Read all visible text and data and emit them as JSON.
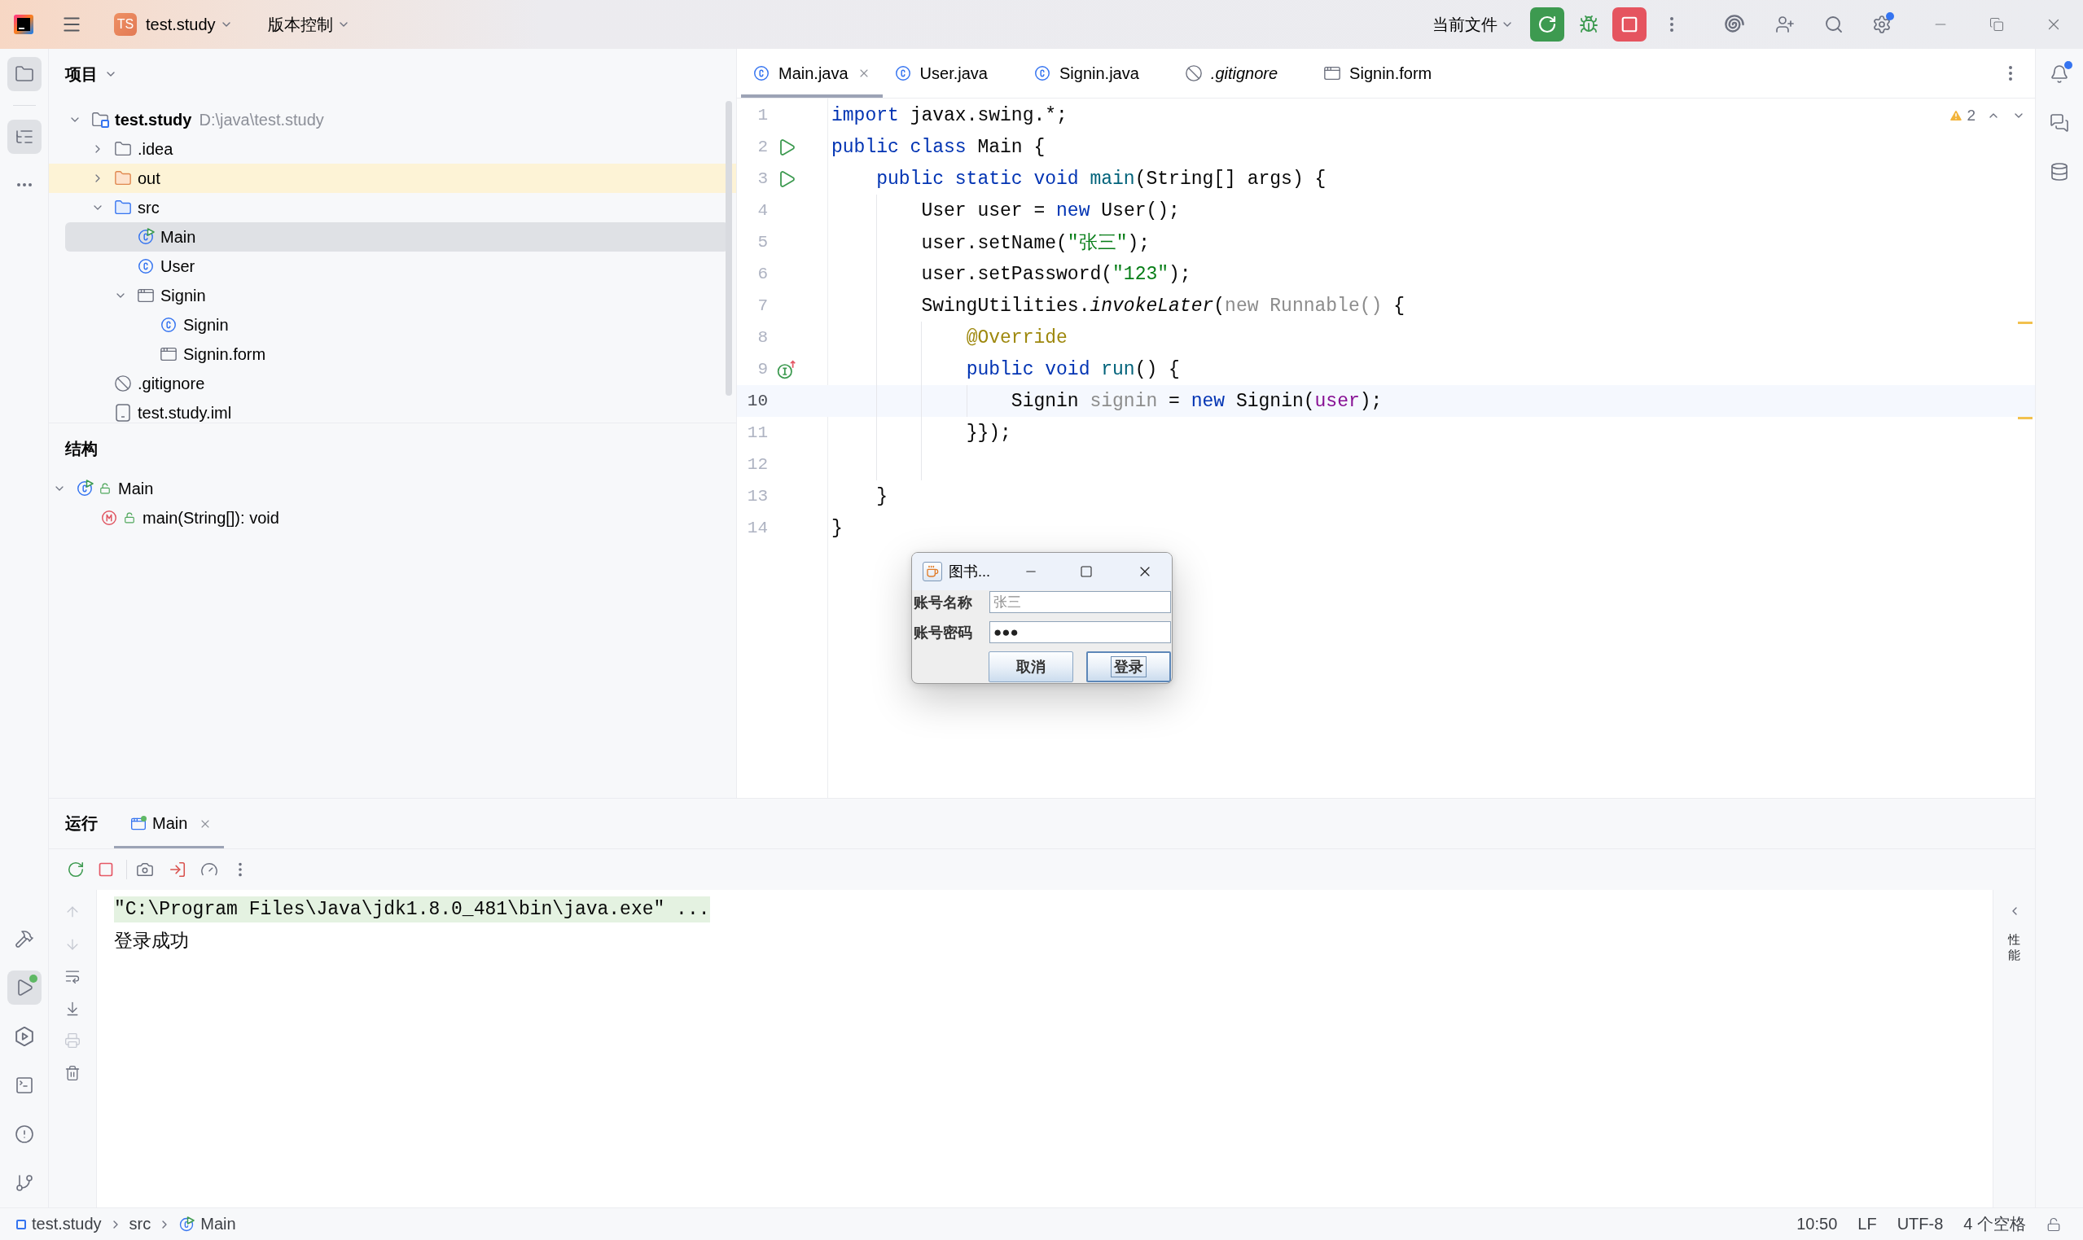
{
  "title_bar": {
    "project_badge": "TS",
    "project": "test.study",
    "vcs_menu": "版本控制",
    "run_target": "当前文件",
    "settings_badge": true
  },
  "left_toolbar": {
    "top": [
      {
        "selected": true
      },
      {
        "selected": true
      }
    ],
    "bottom": [
      {
        "selected": false
      },
      {
        "selected": true
      },
      {
        "selected": false
      },
      {
        "selected": false
      },
      {
        "selected": false
      },
      {
        "selected": false
      }
    ],
    "run_badge": true
  },
  "project_panel": {
    "title": "项目",
    "tree": [
      {
        "label": "test.study",
        "path": "D:\\java\\test.study",
        "kind": "module",
        "expanded": true,
        "selected": false,
        "children": [
          {
            "label": ".idea",
            "kind": "folder",
            "expanded": false,
            "selected": false
          },
          {
            "label": "out",
            "kind": "excluded_folder",
            "expanded": false,
            "selected": false
          },
          {
            "label": "src",
            "kind": "source_folder",
            "expanded": true,
            "selected": false,
            "children": [
              {
                "label": "Main",
                "kind": "main_class",
                "selected": true
              },
              {
                "label": "User",
                "kind": "class",
                "selected": false
              },
              {
                "label": "Signin",
                "kind": "form_group",
                "expanded": true,
                "selected": false,
                "children": [
                  {
                    "label": "Signin",
                    "kind": "class",
                    "selected": false
                  },
                  {
                    "label": "Signin.form",
                    "kind": "form",
                    "selected": false
                  }
                ]
              }
            ]
          },
          {
            "label": ".gitignore",
            "kind": "ignore_file",
            "selected": false
          },
          {
            "label": "test.study.iml",
            "kind": "module_file",
            "selected": false
          }
        ]
      }
    ]
  },
  "structure_panel": {
    "title": "结构",
    "tree": [
      {
        "label": "Main",
        "kind": "main_class",
        "expanded": true,
        "selected": false,
        "children": [
          {
            "label": "main(String[]): void",
            "kind": "method",
            "selected": false
          }
        ]
      }
    ]
  },
  "editor": {
    "tabs": [
      {
        "label": "Main.java",
        "kind": "class",
        "selected": true
      },
      {
        "label": "User.java",
        "kind": "class",
        "selected": false
      },
      {
        "label": "Signin.java",
        "kind": "class",
        "selected": false
      },
      {
        "label": ".gitignore",
        "kind": "ignored",
        "selected": false
      },
      {
        "label": "Signin.form",
        "kind": "form",
        "selected": false
      }
    ],
    "warning_count": "2",
    "lines": [
      {
        "number": "1",
        "current": false,
        "warning": false,
        "tokens": [
          {
            "kind": "keyword",
            "text": "import"
          },
          {
            "kind": "plain",
            "text": " javax.swing.*;"
          }
        ]
      },
      {
        "number": "2",
        "current": false,
        "warning": false,
        "gutter": {
          "kind": "run"
        },
        "tokens": [
          {
            "kind": "keyword",
            "text": "public class"
          },
          {
            "kind": "plain",
            "text": " Main {"
          }
        ]
      },
      {
        "number": "3",
        "current": false,
        "warning": false,
        "gutter": {
          "kind": "run"
        },
        "tokens": [
          {
            "kind": "keyword",
            "text": "    public static void "
          },
          {
            "kind": "method",
            "text": "main"
          },
          {
            "kind": "plain",
            "text": "(String[] args) {"
          }
        ]
      },
      {
        "number": "4",
        "current": false,
        "warning": false,
        "tokens": [
          {
            "kind": "plain",
            "text": "        User user = "
          },
          {
            "kind": "keyword",
            "text": "new"
          },
          {
            "kind": "plain",
            "text": " User();"
          }
        ]
      },
      {
        "number": "5",
        "current": false,
        "warning": false,
        "tokens": [
          {
            "kind": "plain",
            "text": "        user.setName("
          },
          {
            "kind": "string",
            "text": "\"张三\""
          },
          {
            "kind": "plain",
            "text": ");"
          }
        ]
      },
      {
        "number": "6",
        "current": false,
        "warning": false,
        "tokens": [
          {
            "kind": "plain",
            "text": "        user.setPassword("
          },
          {
            "kind": "string",
            "text": "\"123\""
          },
          {
            "kind": "plain",
            "text": ");"
          }
        ]
      },
      {
        "number": "7",
        "current": false,
        "warning": true,
        "tokens": [
          {
            "kind": "plain",
            "text": "        SwingUtilities."
          },
          {
            "kind": "static_call",
            "text": "invokeLater"
          },
          {
            "kind": "plain",
            "text": "("
          },
          {
            "kind": "hint",
            "text": "new Runnable()"
          },
          {
            "kind": "plain",
            "text": " {"
          }
        ]
      },
      {
        "number": "8",
        "current": false,
        "warning": false,
        "tokens": [
          {
            "kind": "annotation",
            "text": "            @Override"
          }
        ]
      },
      {
        "number": "9",
        "current": false,
        "warning": false,
        "gutter": {
          "kind": "implements"
        },
        "tokens": [
          {
            "kind": "keyword",
            "text": "            public void "
          },
          {
            "kind": "method",
            "text": "run"
          },
          {
            "kind": "plain",
            "text": "() {"
          }
        ]
      },
      {
        "number": "10",
        "current": true,
        "warning": true,
        "tokens": [
          {
            "kind": "plain",
            "text": "                Signin "
          },
          {
            "kind": "unused",
            "text": "signin"
          },
          {
            "kind": "plain",
            "text": " = "
          },
          {
            "kind": "keyword",
            "text": "new"
          },
          {
            "kind": "plain",
            "text": " Signin("
          },
          {
            "kind": "captured",
            "text": "user"
          },
          {
            "kind": "plain",
            "text": ");"
          }
        ]
      },
      {
        "number": "11",
        "current": false,
        "warning": false,
        "tokens": [
          {
            "kind": "plain",
            "text": "            }});"
          }
        ]
      },
      {
        "number": "12",
        "current": false,
        "warning": false
      },
      {
        "number": "13",
        "current": false,
        "warning": false,
        "tokens": [
          {
            "kind": "plain",
            "text": "    }"
          }
        ]
      },
      {
        "number": "14",
        "current": false,
        "warning": false,
        "tokens": [
          {
            "kind": "plain",
            "text": "}"
          }
        ]
      }
    ]
  },
  "dialog": {
    "title": "图书...",
    "fields": [
      {
        "label": "账号名称",
        "placeholder": "张三"
      },
      {
        "label": "账号密码",
        "value": "●●●"
      }
    ],
    "buttons": [
      {
        "label": "取消",
        "focused": false
      },
      {
        "label": "登录",
        "focused": true
      }
    ]
  },
  "run_panel": {
    "title": "运行",
    "tabs": [
      {
        "label": "Main",
        "selected": true
      }
    ],
    "side_tools": [
      {
        "disabled": true
      },
      {
        "disabled": true
      },
      {
        "disabled": false
      },
      {
        "disabled": false
      },
      {
        "disabled": true
      },
      {
        "disabled": false
      }
    ],
    "console": [
      {
        "kind": "command",
        "text": "\"C:\\Program Files\\Java\\jdk1.8.0_481\\bin\\java.exe\" ..."
      },
      {
        "kind": "output",
        "text": "登录成功"
      }
    ],
    "side_panel_label": "性能"
  },
  "right_toolbar": {
    "notification_badge": true
  },
  "status_bar": {
    "breadcrumbs": [
      {
        "label": "test.study",
        "kind": "module"
      },
      {
        "label": "src",
        "kind": "folder"
      },
      {
        "label": "Main",
        "kind": "main_class"
      }
    ],
    "caret": "10:50",
    "line_ending": "LF",
    "encoding": "UTF-8",
    "indent_setting": "4 个空格"
  }
}
